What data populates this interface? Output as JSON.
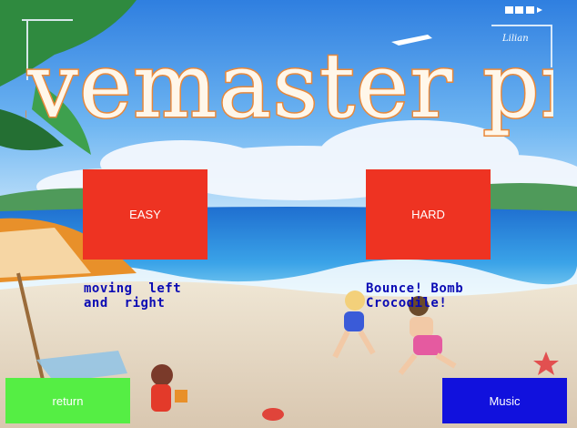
{
  "title": "divemaster pro",
  "buttons": {
    "easy": "EASY",
    "hard": "HARD",
    "return": "return",
    "music": "Music"
  },
  "descriptions": {
    "easy": "moving  left\nand  right",
    "hard": "Bounce! Bomb\nCrocodile!"
  },
  "signature": "Lilian",
  "colors": {
    "easy_hard_bg": "#ee3322",
    "return_bg": "#55ee44",
    "music_bg": "#1111dd",
    "description_text": "#0a0ab4",
    "title_stroke": "#e8883a"
  }
}
